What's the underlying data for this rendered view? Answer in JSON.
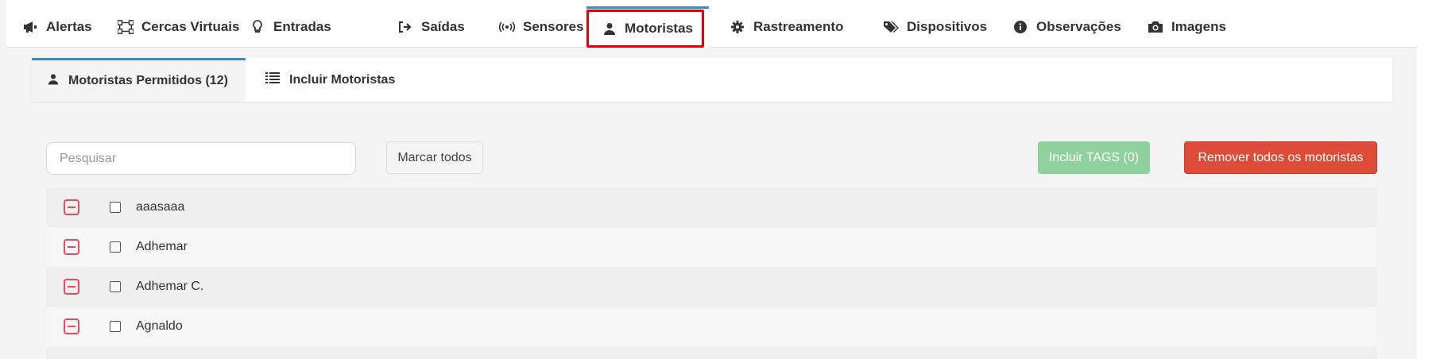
{
  "tabs": [
    {
      "label": "Alertas",
      "icon": "megaphone-icon"
    },
    {
      "label": "Cercas Virtuais",
      "icon": "vector-square-icon"
    },
    {
      "label": "Entradas",
      "icon": "lightbulb-icon"
    },
    {
      "label": "Saídas",
      "icon": "sign-out-icon"
    },
    {
      "label": "Sensores",
      "icon": "broadcast-icon"
    },
    {
      "label": "Motoristas",
      "icon": "user-icon"
    },
    {
      "label": "Rastreamento",
      "icon": "gear-icon"
    },
    {
      "label": "Dispositivos",
      "icon": "tags-icon"
    },
    {
      "label": "Observações",
      "icon": "info-circle-icon"
    },
    {
      "label": "Imagens",
      "icon": "camera-icon"
    }
  ],
  "active_tab": "Motoristas",
  "subtabs": {
    "allowed": "Motoristas Permitidos (12)",
    "include": "Incluir Motoristas"
  },
  "search": {
    "placeholder": "Pesquisar",
    "value": ""
  },
  "buttons": {
    "select_all": "Marcar todos",
    "include_tags": "Incluir TAGS (0)",
    "remove_all": "Remover todos os motoristas"
  },
  "drivers": [
    "aaasaaa",
    "Adhemar",
    "Adhemar C.",
    "Agnaldo"
  ],
  "colors": {
    "accent": "#3c8dbc",
    "highlight": "#e0000a",
    "success": "#8fd19e",
    "danger": "#dd4b39"
  }
}
